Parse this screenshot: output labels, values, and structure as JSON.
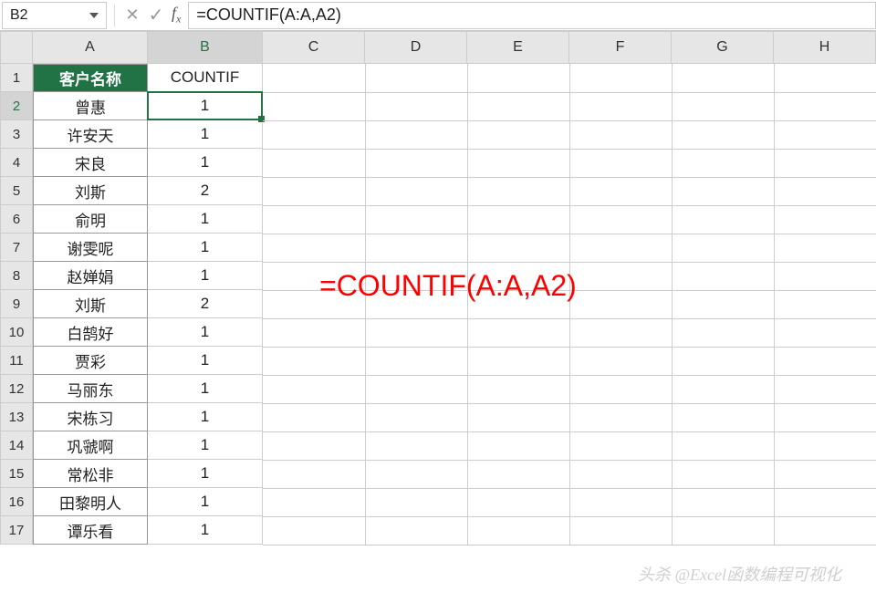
{
  "name_box": "B2",
  "formula_bar": "=COUNTIF(A:A,A2)",
  "columns": [
    "A",
    "B",
    "C",
    "D",
    "E",
    "F",
    "G",
    "H"
  ],
  "row_numbers": [
    1,
    2,
    3,
    4,
    5,
    6,
    7,
    8,
    9,
    10,
    11,
    12,
    13,
    14,
    15,
    16,
    17
  ],
  "headers": {
    "a": "客户名称",
    "b": "COUNTIF"
  },
  "col_a": [
    "曾惠",
    "许安天",
    "宋良",
    "刘斯",
    "俞明",
    "谢雯呢",
    "赵婵娟",
    "刘斯",
    "白鹄好",
    "贾彩",
    "马丽东",
    "宋栋习",
    "巩虢啊",
    "常松非",
    "田黎明人",
    "谭乐看"
  ],
  "col_b": [
    "1",
    "1",
    "1",
    "2",
    "1",
    "1",
    "1",
    "2",
    "1",
    "1",
    "1",
    "1",
    "1",
    "1",
    "1",
    "1"
  ],
  "overlay": "=COUNTIF(A:A,A2)",
  "watermark": "头杀 @Excel函数编程可视化",
  "active_row": 2,
  "active_col": "B"
}
